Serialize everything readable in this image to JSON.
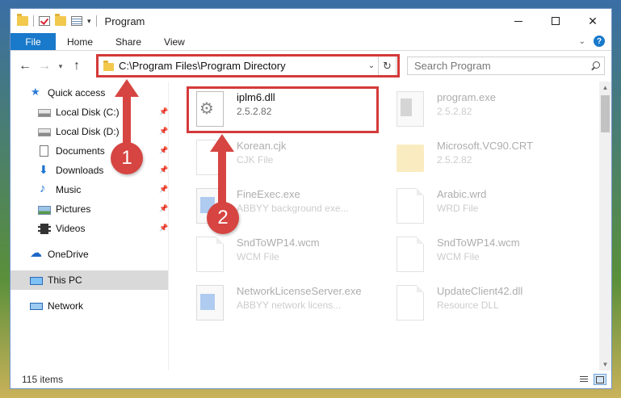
{
  "window": {
    "title": "Program",
    "controls": {
      "close_symbol": "✕"
    }
  },
  "ribbon": {
    "tabs": [
      "File",
      "Home",
      "Share",
      "View"
    ]
  },
  "address_bar": {
    "path": "C:\\Program Files\\Program Directory",
    "search_placeholder": "Search Program"
  },
  "nav_pane": {
    "items": [
      {
        "label": "Quick access",
        "icon": "star-icon",
        "pinned": false
      },
      {
        "label": "Local Disk (C:)",
        "icon": "disk-icon",
        "pinned": true
      },
      {
        "label": "Local Disk (D:)",
        "icon": "disk-icon",
        "pinned": true
      },
      {
        "label": "Documents",
        "icon": "documents-icon",
        "pinned": true
      },
      {
        "label": "Downloads",
        "icon": "downloads-icon",
        "pinned": true
      },
      {
        "label": "Music",
        "icon": "music-icon",
        "pinned": true
      },
      {
        "label": "Pictures",
        "icon": "pictures-icon",
        "pinned": true
      },
      {
        "label": "Videos",
        "icon": "videos-icon",
        "pinned": true
      },
      {
        "label": "OneDrive",
        "icon": "onedrive-icon"
      },
      {
        "label": "This PC",
        "icon": "this-pc-icon",
        "selected": true
      },
      {
        "label": "Network",
        "icon": "network-icon"
      }
    ]
  },
  "files": [
    {
      "name": "iplm6.dll",
      "detail": "2.5.2.82",
      "icon": "dll-file-icon",
      "highlighted": true
    },
    {
      "name": "program.exe",
      "detail": "2.5.2.82",
      "icon": "exe-file-icon"
    },
    {
      "name": "Korean.cjk",
      "detail": "CJK File",
      "icon": "document-file-icon"
    },
    {
      "name": "Microsoft.VC90.CRT",
      "detail": "2.5.2.82",
      "icon": "folder-icon"
    },
    {
      "name": "FineExec.exe",
      "detail": "ABBYY background exe...",
      "icon": "app-file-icon"
    },
    {
      "name": "Arabic.wrd",
      "detail": "WRD File",
      "icon": "document-file-icon"
    },
    {
      "name": "SndToWP14.wcm",
      "detail": "WCM File",
      "icon": "document-file-icon"
    },
    {
      "name": "SndToWP14.wcm",
      "detail": "WCM File",
      "icon": "document-file-icon"
    },
    {
      "name": "NetworkLicenseServer.exe",
      "detail": "ABBYY network licens...",
      "icon": "app-file-icon"
    },
    {
      "name": "UpdateClient42.dll",
      "detail": "Resource DLL",
      "icon": "document-file-icon"
    }
  ],
  "status_bar": {
    "item_count": "115 items"
  },
  "callouts": [
    {
      "number": "1",
      "color": "#d64541"
    },
    {
      "number": "2",
      "color": "#d64541"
    }
  ],
  "colors": {
    "accent": "#1979ca",
    "highlight": "#d43a3a"
  }
}
